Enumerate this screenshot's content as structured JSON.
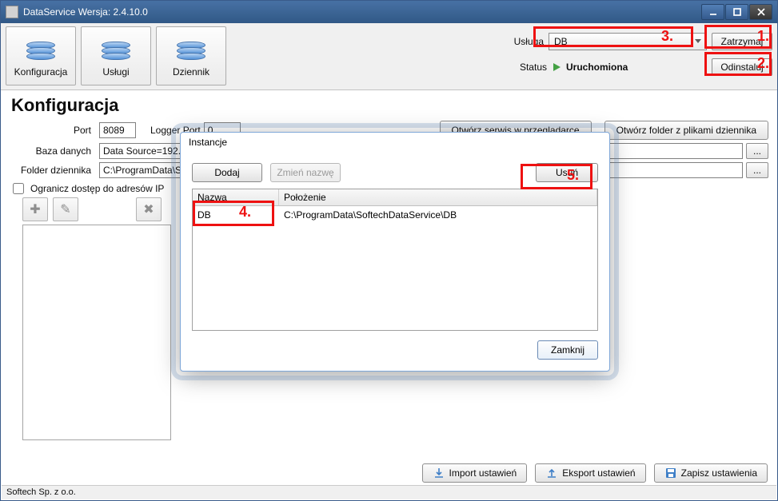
{
  "titlebar": {
    "title": "DataService  Wersja: 2.4.10.0"
  },
  "toolbar": {
    "buttons": {
      "config": "Konfiguracja",
      "services": "Usługi",
      "log": "Dziennik"
    },
    "service_label": "Usługa",
    "service_value": "DB",
    "status_label": "Status",
    "status_value": "Uruchomiona",
    "stop_label": "Zatrzymaj",
    "uninstall_label": "Odinstaluj"
  },
  "page": {
    "title": "Konfiguracja",
    "port_label": "Port",
    "port_value": "8089",
    "logger_port_label": "Logger Port",
    "logger_port_value": "0",
    "open_browser": "Otwórz serwis w przeglądarce",
    "open_folder": "Otwórz folder z plikami dziennika",
    "db_label": "Baza danych",
    "db_value": "Data Source=192.",
    "logfolder_label": "Folder dziennika",
    "logfolder_value": "C:\\ProgramData\\S",
    "browse": "...",
    "ip_check_label": "Ogranicz dostęp do adresów IP"
  },
  "footer": {
    "import": "Import ustawień",
    "export": "Eksport ustawień",
    "save": "Zapisz ustawienia"
  },
  "statusbar": "Softech Sp. z o.o.",
  "dialog": {
    "title": "Instancje",
    "add": "Dodaj",
    "rename": "Zmień nazwę",
    "delete": "Usuń",
    "col_name": "Nazwa",
    "col_path": "Położenie",
    "rows": [
      {
        "name": "DB",
        "path": "C:\\ProgramData\\SoftechDataService\\DB"
      }
    ],
    "close": "Zamknij"
  },
  "annotations": {
    "a1": "1.",
    "a2": "2.",
    "a3": "3.",
    "a4": "4.",
    "a5": "5."
  }
}
